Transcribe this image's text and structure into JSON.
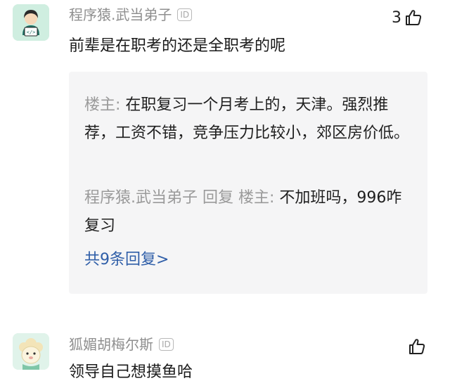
{
  "comments": [
    {
      "username": "程序猿.武当弟子",
      "badge": "ID",
      "like_count": "3",
      "text": "前辈是在职考的还是全职考的呢",
      "replies": [
        {
          "author": "楼主",
          "separator": ": ",
          "text": "在职复习一个月考上的，天津。强烈推荐，工资不错，竞争压力比较小，郊区房价低。"
        },
        {
          "author": "程序猿.武当弟子 回复 楼主",
          "separator": ": ",
          "text": "不加班吗，996咋复习"
        }
      ],
      "more_replies": "共9条回复>"
    },
    {
      "username": "狐媚胡梅尔斯",
      "badge": "ID",
      "like_count": "",
      "text": "领导自己想摸鱼哈"
    }
  ],
  "colors": {
    "username": "#8f8f8f",
    "reply_author": "#9a9a9a",
    "link": "#2f5ea8",
    "reply_bg": "#f5f5f6"
  },
  "icons": {
    "avatar_1": "programmer-avatar-icon",
    "avatar_2": "sheep-avatar-icon",
    "like": "thumbs-up-icon"
  }
}
